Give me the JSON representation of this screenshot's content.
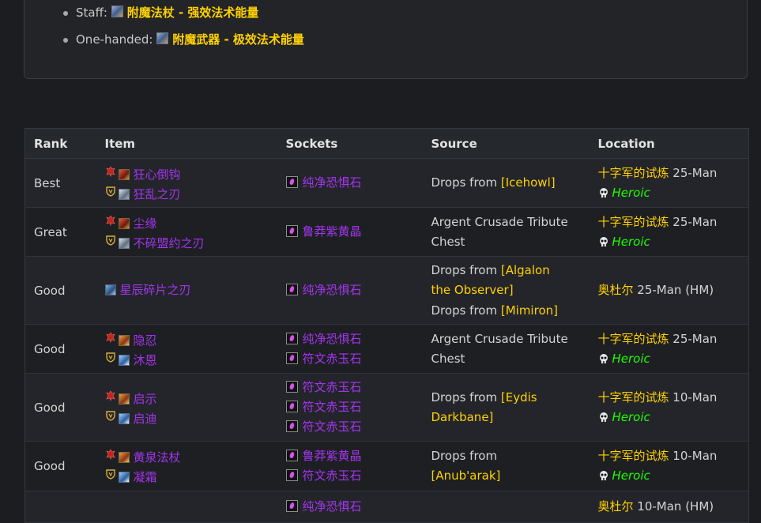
{
  "enchants": [
    {
      "label": "Staff: ",
      "enchant": "附魔法杖 - 强效法术能量"
    },
    {
      "label": "One-handed: ",
      "enchant": "附魔武器 - 极效法术能量"
    }
  ],
  "table": {
    "headers": {
      "rank": "Rank",
      "item": "Item",
      "sockets": "Sockets",
      "source": "Source",
      "location": "Location"
    },
    "rows": [
      {
        "rank": "Best",
        "items": [
          {
            "faction": "horde",
            "name": "狂心倒钩",
            "icon": "red"
          },
          {
            "faction": "alliance",
            "name": "狂乱之刃",
            "icon": "silver"
          }
        ],
        "sockets": [
          "纯净恐惧石"
        ],
        "source": [
          {
            "text": "Drops from ",
            "link": "[Icehowl]"
          }
        ],
        "location": {
          "zone": "十字军的试炼",
          "size": " 25-Man",
          "heroic": "Heroic"
        }
      },
      {
        "rank": "Great",
        "items": [
          {
            "faction": "horde",
            "name": "尘缘",
            "icon": "red"
          },
          {
            "faction": "alliance",
            "name": "不碎盟约之刃",
            "icon": "silver"
          }
        ],
        "sockets": [
          "鲁莽紫黄晶"
        ],
        "source": [
          {
            "text": "Argent Crusade Tribute Chest",
            "link": ""
          }
        ],
        "location": {
          "zone": "十字军的试炼",
          "size": " 25-Man",
          "heroic": "Heroic"
        }
      },
      {
        "rank": "Good",
        "items": [
          {
            "faction": "",
            "name": "星辰碎片之刃",
            "icon": "blue"
          }
        ],
        "sockets": [
          "纯净恐惧石"
        ],
        "source": [
          {
            "text": "Drops from ",
            "link": "[Algalon the Observer]"
          },
          {
            "text": "Drops from ",
            "link": "[Mimiron]"
          }
        ],
        "location": {
          "zone": "奥杜尔",
          "size": " 25-Man (HM)",
          "heroic": ""
        }
      },
      {
        "rank": "Good",
        "items": [
          {
            "faction": "horde",
            "name": "隐忍",
            "icon": "orange"
          },
          {
            "faction": "alliance",
            "name": "沐恩",
            "icon": "staff"
          }
        ],
        "sockets": [
          "纯净恐惧石",
          "符文赤玉石"
        ],
        "source": [
          {
            "text": "Argent Crusade Tribute Chest",
            "link": ""
          }
        ],
        "location": {
          "zone": "十字军的试炼",
          "size": " 25-Man",
          "heroic": "Heroic"
        }
      },
      {
        "rank": "Good",
        "items": [
          {
            "faction": "horde",
            "name": "启示",
            "icon": "orange"
          },
          {
            "faction": "alliance",
            "name": "启迪",
            "icon": "staff"
          }
        ],
        "sockets": [
          "符文赤玉石",
          "符文赤玉石",
          "符文赤玉石"
        ],
        "source": [
          {
            "text": "Drops from ",
            "link": "[Eydis Darkbane]"
          }
        ],
        "location": {
          "zone": "十字军的试炼",
          "size": " 10-Man",
          "heroic": "Heroic"
        }
      },
      {
        "rank": "Good",
        "items": [
          {
            "faction": "horde",
            "name": "黄泉法杖",
            "icon": "orange"
          },
          {
            "faction": "alliance",
            "name": "凝霜",
            "icon": "staff"
          }
        ],
        "sockets": [
          "鲁莽紫黄晶",
          "符文赤玉石"
        ],
        "source": [
          {
            "text": "Drops from ",
            "link": "[Anub'arak]"
          }
        ],
        "location": {
          "zone": "十字军的试炼",
          "size": " 10-Man",
          "heroic": "Heroic"
        }
      },
      {
        "rank": "",
        "items": [],
        "sockets": [
          "纯净恐惧石"
        ],
        "source": [],
        "location": {
          "zone": "奥杜尔",
          "size": " 10-Man (HM)",
          "heroic": ""
        }
      }
    ]
  },
  "colors": {
    "epic": "#a335ee",
    "gold": "#ffd100",
    "heroic": "#1eff00",
    "background": "#1b1d20"
  }
}
